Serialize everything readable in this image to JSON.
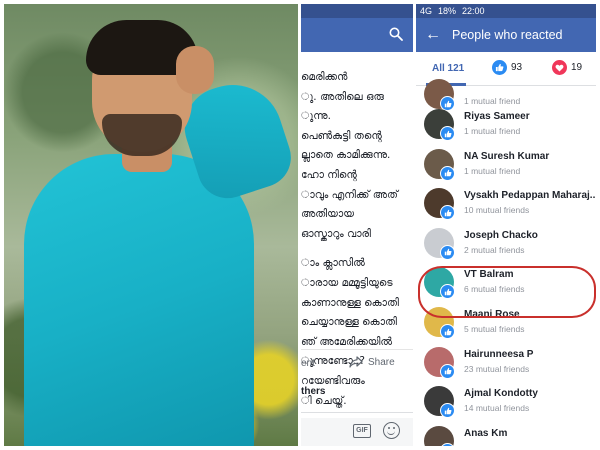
{
  "status_bar": {
    "network": "4G",
    "battery": "18%",
    "time": "22:00"
  },
  "header": {
    "title": "People who reacted"
  },
  "tabs": [
    {
      "label": "All 121"
    },
    {
      "label": "93",
      "icon": "like-icon"
    },
    {
      "label": "19",
      "icon": "love-icon"
    }
  ],
  "people": [
    {
      "name": "Riyas Sameer",
      "mutual": "1 mutual friend",
      "avatar_color": "#3b3f3a"
    },
    {
      "name": "NA Suresh Kumar",
      "mutual": "1 mutual friend",
      "avatar_color": "#6b5b4a"
    },
    {
      "name": "Vysakh Pedappan Maharaj...",
      "mutual": "10 mutual friends",
      "avatar_color": "#4d3a2c"
    },
    {
      "name": "Joseph Chacko",
      "mutual": "2 mutual friends",
      "avatar_color": "#c9ccd1"
    },
    {
      "name": "VT Balram",
      "mutual": "6 mutual friends",
      "avatar_color": "#2ea8a4"
    },
    {
      "name": "Maani Rose",
      "mutual": "5 mutual friends",
      "avatar_color": "#e0b84a"
    },
    {
      "name": "Hairunneesa P",
      "mutual": "23 mutual friends",
      "avatar_color": "#b86b6b"
    },
    {
      "name": "Ajmal Kondotty",
      "mutual": "14 mutual friends",
      "avatar_color": "#3a3a3a"
    },
    {
      "name": "Anas Km",
      "mutual": "",
      "avatar_color": "#5a4a40"
    }
  ],
  "top_partial": {
    "mutual": "1 mutual friend"
  },
  "post": {
    "lines": [
      "മെരിക്കൻ",
      "ു. അതിലെ ഒരു",
      "ുന്നു.",
      "പെൺകുട്ടി തന്റെ",
      "ല്ലാതെ കാമിക്കുന്നു.",
      "ഹോ നിന്റെ",
      "ാവും എനിക്ക് അത്",
      "അതിയായ",
      " ഓസ്കാറും വാരി",
      "",
      "ാം ക്ലാസിൽ",
      "ാരായ മമ്മൂട്ടിയുടെ",
      "കാണാനുള്ള കൊതി",
      "ചെയ്യാനുള്ള കൊതി",
      "ഞ് അമേരിക്കയിൽ",
      "ുന്നുണ്ടോ..?",
      "റയേണ്ടിവരും",
      "ി ചെയ്ത്."
    ],
    "comment_label": "ent",
    "share_label": "Share",
    "others_label": "thers"
  },
  "composer": {
    "gif_label": "GIF"
  },
  "colors": {
    "fb_blue": "#4267b2",
    "status_blue": "#35518f",
    "highlight": "#c9302c",
    "like": "#2b8bf2",
    "love": "#f0375a"
  }
}
